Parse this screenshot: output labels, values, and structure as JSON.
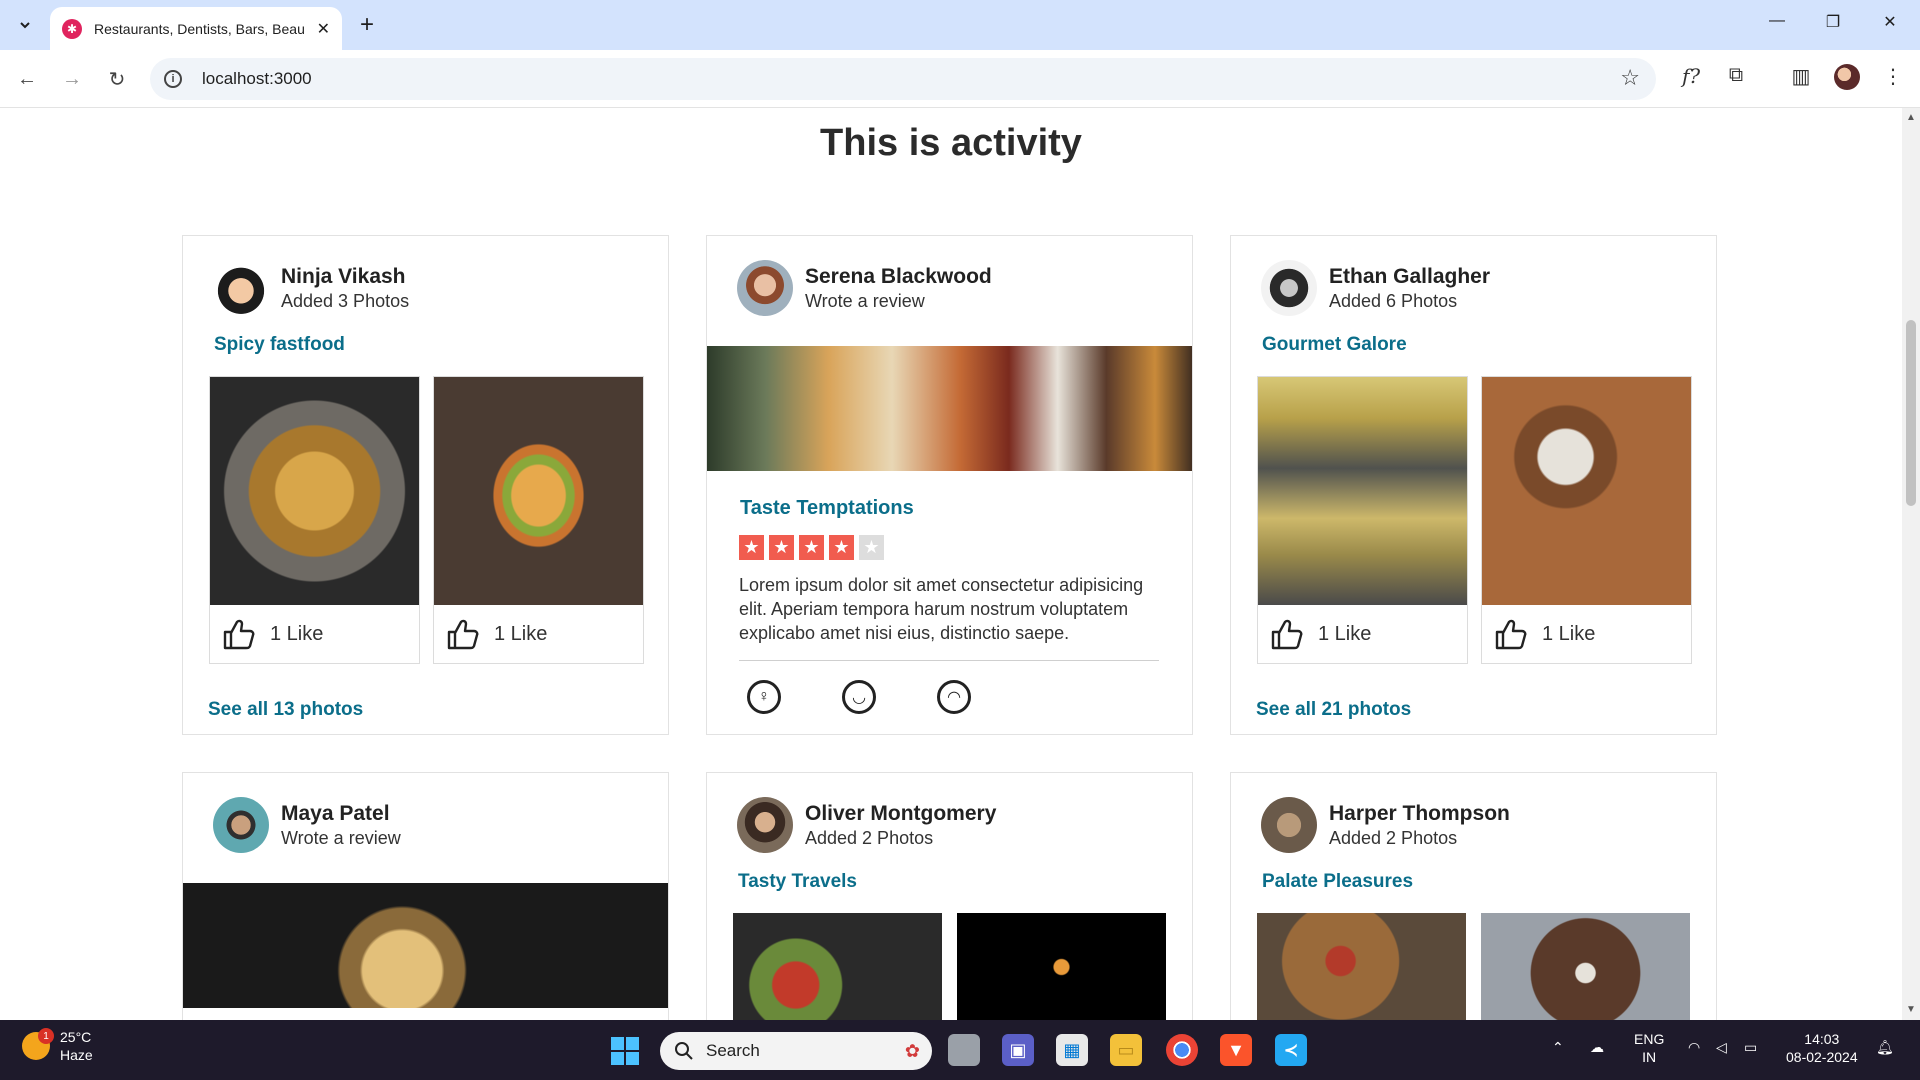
{
  "browser": {
    "tab_title": "Restaurants, Dentists, Bars, Beauty",
    "url": "localhost:3000"
  },
  "page": {
    "title": "This is activity"
  },
  "cards": [
    {
      "name": "Ninja Vikash",
      "action": "Added 3 Photos",
      "business": "Spicy fastfood",
      "photos": [
        {
          "likes": "1 Like"
        },
        {
          "likes": "1 Like"
        }
      ],
      "see_all": "See all 13 photos"
    },
    {
      "name": "Serena Blackwood",
      "action": "Wrote a review",
      "business": "Taste Temptations",
      "rating": 4,
      "review": "Lorem ipsum dolor sit amet consectetur adipisicing elit. Aperiam tempora harum nostrum voluptatem explicabo amet nisi eius, distinctio saepe."
    },
    {
      "name": "Ethan Gallagher",
      "action": "Added 6 Photos",
      "business": "Gourmet Galore",
      "photos": [
        {
          "likes": "1 Like"
        },
        {
          "likes": "1 Like"
        }
      ],
      "see_all": "See all 21 photos"
    },
    {
      "name": "Maya Patel",
      "action": "Wrote a review"
    },
    {
      "name": "Oliver Montgomery",
      "action": "Added 2 Photos",
      "business": "Tasty Travels"
    },
    {
      "name": "Harper Thompson",
      "action": "Added 2 Photos",
      "business": "Palate Pleasures"
    }
  ],
  "taskbar": {
    "temperature": "25°C",
    "weather": "Haze",
    "weather_badge": "1",
    "search_placeholder": "Search",
    "lang_1": "ENG",
    "lang_2": "IN",
    "time": "14:03",
    "date": "08-02-2024"
  },
  "colors": {
    "accent_link": "#0b6e8a",
    "star_on": "#f15c4f",
    "star_off": "#dddddd"
  }
}
